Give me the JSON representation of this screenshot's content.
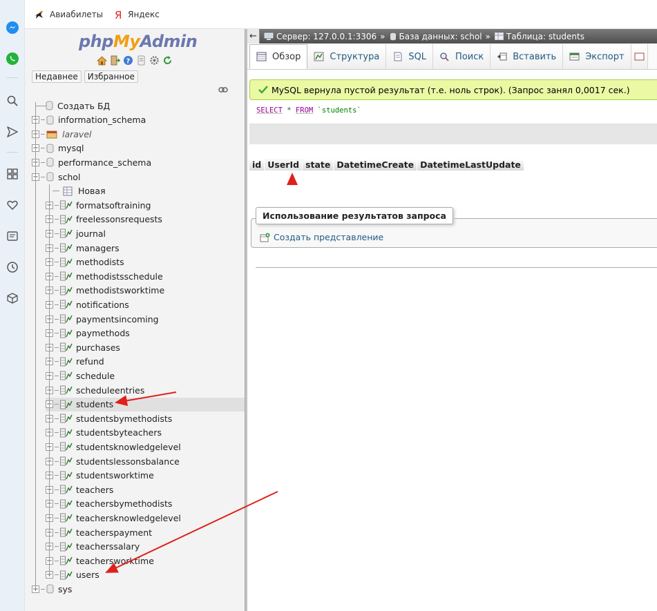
{
  "bookmarks": [
    {
      "label": "Авиабилеты",
      "icon": "plane-icon"
    },
    {
      "label": "Яндекс",
      "icon": "yandex-icon"
    }
  ],
  "logo": {
    "php": "php",
    "my": "My",
    "admin": "Admin"
  },
  "nav_tabs": {
    "recent": "Недавнее",
    "favorites": "Избранное"
  },
  "tree": {
    "create_db": "Создать БД",
    "databases": [
      {
        "name": "information_schema"
      },
      {
        "name": "laravel"
      },
      {
        "name": "mysql"
      },
      {
        "name": "performance_schema"
      },
      {
        "name": "schol"
      }
    ],
    "new_table": "Новая",
    "tables": [
      "formatsoftraining",
      "freelessonsrequests",
      "journal",
      "managers",
      "methodists",
      "methodistsschedule",
      "methodistsworktime",
      "notifications",
      "paymentsincoming",
      "paymethods",
      "purchases",
      "refund",
      "schedule",
      "scheduleentries",
      "students",
      "studentsbymethodists",
      "studentsbyteachers",
      "studentsknowledgelevel",
      "studentslessonsbalance",
      "studentsworktime",
      "teachers",
      "teachersbymethodists",
      "teachersknowledgelevel",
      "teacherspayment",
      "teacherssalary",
      "teachersworktime",
      "users"
    ],
    "last_db": "sys",
    "expand_symbol": "+",
    "collapse_symbol": "−"
  },
  "breadcrumb": {
    "back": "←",
    "server": "Сервер: 127.0.0.1:3306",
    "database": "База данных: schol",
    "table": "Таблица: students",
    "separator": "»"
  },
  "tabs": [
    "Обзор",
    "Структура",
    "SQL",
    "Поиск",
    "Вставить",
    "Экспорт"
  ],
  "message": "MySQL вернула пустой результат (т.е. ноль строк). (Запрос занял 0,0017 сек.)",
  "sql": {
    "select": "SELECT",
    "star": "*",
    "from": "FROM",
    "table": "`students`"
  },
  "columns": [
    "id",
    "UserId",
    "state",
    "DatetimeCreate",
    "DatetimeLastUpdate"
  ],
  "query_results": {
    "legend": "Использование результатов запроса",
    "create_view": "Создать представление"
  },
  "colors": {
    "accent_link": "#235a81",
    "success_bg": "#ebf8a4",
    "success_border": "#a2d246",
    "arrow": "#e0201a"
  }
}
